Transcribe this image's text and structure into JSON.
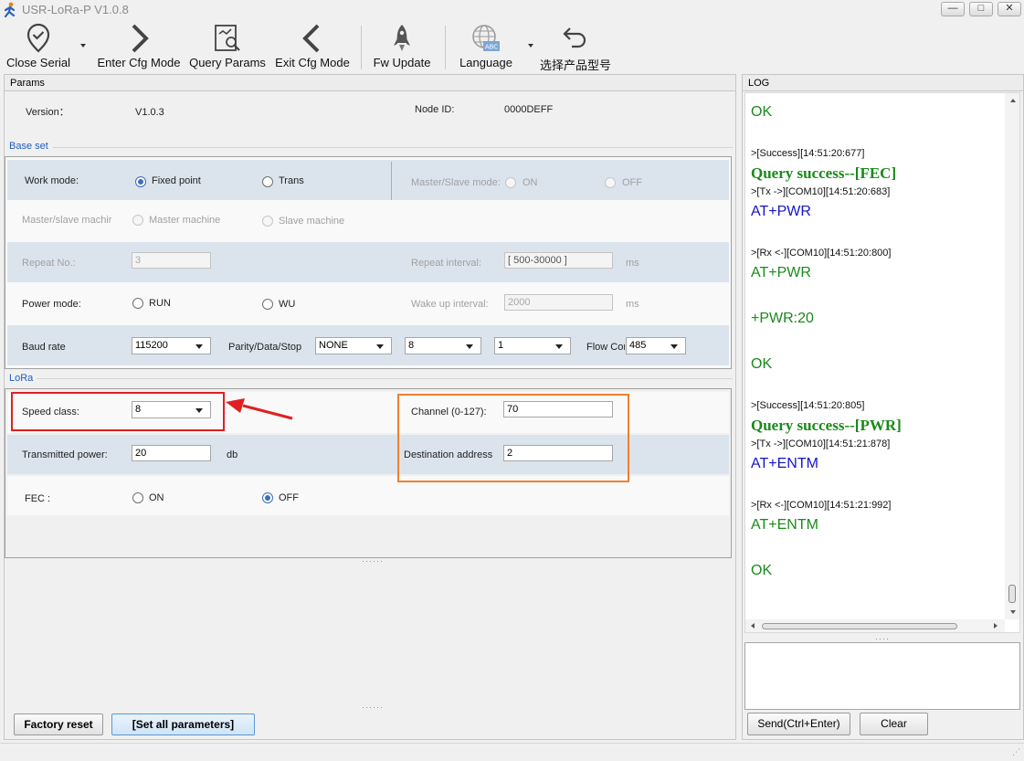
{
  "window": {
    "title": "USR-LoRa-P V1.0.8",
    "min": "—",
    "max": "□",
    "close": "✕"
  },
  "toolbar": [
    {
      "label": "Close Serial"
    },
    {
      "label": "Enter Cfg Mode"
    },
    {
      "label": "Query Params"
    },
    {
      "label": "Exit Cfg Mode"
    },
    {
      "label": "Fw Update"
    },
    {
      "label": "Language"
    },
    {
      "label": "选择产品型号"
    }
  ],
  "params": {
    "header": "Params",
    "version_label": "Version：",
    "version_value": "V1.0.3",
    "node_label": "Node ID:",
    "node_value": "0000DEFF"
  },
  "baseset": {
    "title": "Base set",
    "work_mode_label": "Work mode:",
    "fixed_point": "Fixed point",
    "trans": "Trans",
    "ms_mode_label": "Master/Slave mode:",
    "ms_on": "ON",
    "ms_off": "OFF",
    "ms_machine_label": "Master/slave machir",
    "master_machine": "Master machine",
    "slave_machine": "Slave machine",
    "repeat_no_label": "Repeat No.:",
    "repeat_no_value": "3",
    "repeat_interval_label": "Repeat interval:",
    "repeat_interval_value": "[ 500-30000 ]",
    "ms1": "ms",
    "power_mode_label": "Power mode:",
    "run": "RUN",
    "wu": "WU",
    "wake_label": "Wake up interval:",
    "wake_value": "2000",
    "ms2": "ms",
    "baud_label": "Baud rate",
    "baud_value": "115200",
    "parity_label": "Parity/Data/Stop",
    "parity_value": "NONE",
    "data_value": "8",
    "stop_value": "1",
    "flow_label": "Flow Cor",
    "flow_value": "485"
  },
  "lora": {
    "title": "LoRa",
    "speed_label": "Speed class:",
    "speed_value": "8",
    "channel_label": "Channel (0-127):",
    "channel_value": "70",
    "power_label": "Transmitted power:",
    "power_value": "20",
    "power_unit": "db",
    "dest_label": "Destination address",
    "dest_value": "2",
    "fec_label": "FEC :",
    "fec_on": "ON",
    "fec_off": "OFF"
  },
  "bottom": {
    "factory": "Factory reset",
    "setall": "[Set all parameters]"
  },
  "log": {
    "header": "LOG",
    "lines": [
      "OK",
      ">[Success][14:51:20:677]",
      "Query success--[FEC]",
      ">[Tx ->][COM10][14:51:20:683]",
      "AT+PWR",
      ">[Rx <-][COM10][14:51:20:800]",
      "AT+PWR",
      "+PWR:20",
      "OK",
      ">[Success][14:51:20:805]",
      "Query success--[PWR]",
      ">[Tx ->][COM10][14:51:21:878]",
      "AT+ENTM",
      ">[Rx <-][COM10][14:51:21:992]",
      "AT+ENTM",
      "OK"
    ],
    "send": "Send(Ctrl+Enter)",
    "clear": "Clear"
  },
  "colors": {
    "highlight_red": "#e02020",
    "highlight_orange": "#f08030",
    "log_green": "#1a8a1a",
    "log_blue": "#1414c8"
  }
}
